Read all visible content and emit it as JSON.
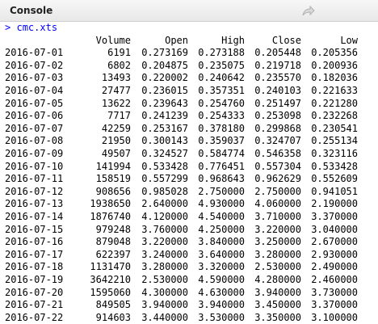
{
  "console": {
    "title": "Console",
    "prompt": ">",
    "command": "cmc.xts"
  },
  "table": {
    "headers": [
      "Volume",
      "Open",
      "High",
      "Close",
      "Low"
    ],
    "rows": [
      [
        "2016-07-01",
        "6191",
        "0.273169",
        "0.273188",
        "0.205448",
        "0.205356"
      ],
      [
        "2016-07-02",
        "6802",
        "0.204875",
        "0.235075",
        "0.219718",
        "0.200936"
      ],
      [
        "2016-07-03",
        "13493",
        "0.220002",
        "0.240642",
        "0.235570",
        "0.182036"
      ],
      [
        "2016-07-04",
        "27477",
        "0.236015",
        "0.357351",
        "0.240103",
        "0.221633"
      ],
      [
        "2016-07-05",
        "13622",
        "0.239643",
        "0.254760",
        "0.251497",
        "0.221280"
      ],
      [
        "2016-07-06",
        "7717",
        "0.241239",
        "0.254333",
        "0.253098",
        "0.232268"
      ],
      [
        "2016-07-07",
        "42259",
        "0.253167",
        "0.378180",
        "0.299868",
        "0.230541"
      ],
      [
        "2016-07-08",
        "21950",
        "0.300143",
        "0.359037",
        "0.324707",
        "0.255134"
      ],
      [
        "2016-07-09",
        "49507",
        "0.324527",
        "0.584774",
        "0.546358",
        "0.323116"
      ],
      [
        "2016-07-10",
        "141994",
        "0.533428",
        "0.776451",
        "0.557304",
        "0.533428"
      ],
      [
        "2016-07-11",
        "158519",
        "0.557299",
        "0.968643",
        "0.962629",
        "0.552609"
      ],
      [
        "2016-07-12",
        "908656",
        "0.985028",
        "2.750000",
        "2.750000",
        "0.941051"
      ],
      [
        "2016-07-13",
        "1938650",
        "2.640000",
        "4.930000",
        "4.060000",
        "2.190000"
      ],
      [
        "2016-07-14",
        "1876740",
        "4.120000",
        "4.540000",
        "3.710000",
        "3.370000"
      ],
      [
        "2016-07-15",
        "979248",
        "3.760000",
        "4.250000",
        "3.220000",
        "3.040000"
      ],
      [
        "2016-07-16",
        "879048",
        "3.220000",
        "3.840000",
        "3.250000",
        "2.670000"
      ],
      [
        "2016-07-17",
        "622397",
        "3.240000",
        "3.640000",
        "3.280000",
        "2.930000"
      ],
      [
        "2016-07-18",
        "1131470",
        "3.280000",
        "3.320000",
        "2.530000",
        "2.490000"
      ],
      [
        "2016-07-19",
        "3642210",
        "2.530000",
        "4.590000",
        "4.280000",
        "2.460000"
      ],
      [
        "2016-07-20",
        "1595060",
        "4.300000",
        "4.630000",
        "3.940000",
        "3.730000"
      ],
      [
        "2016-07-21",
        "849505",
        "3.940000",
        "3.940000",
        "3.450000",
        "3.370000"
      ],
      [
        "2016-07-22",
        "914603",
        "3.440000",
        "3.530000",
        "3.350000",
        "3.100000"
      ]
    ]
  }
}
